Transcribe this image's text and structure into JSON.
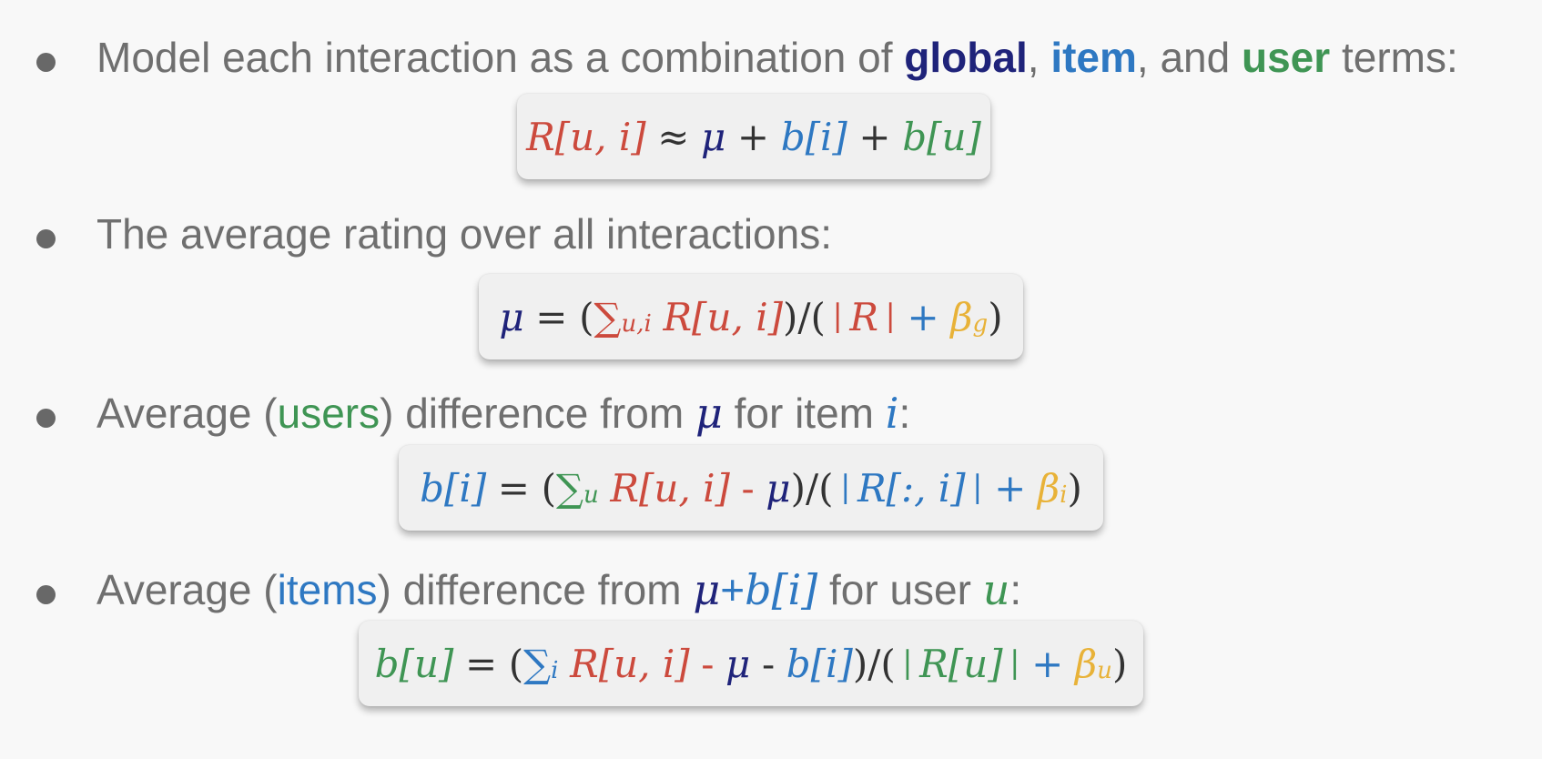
{
  "bullets": [
    {
      "parts": [
        "Model each interaction as a combination of ",
        "global",
        ", ",
        "item",
        ", and ",
        "user",
        " terms:"
      ]
    },
    {
      "parts": [
        "The average rating over all interactions:"
      ]
    },
    {
      "parts": [
        "Average (",
        "users",
        ") difference from ",
        "μ",
        " for item ",
        "i",
        ":"
      ]
    },
    {
      "parts": [
        "Average (",
        "items",
        ") difference from ",
        "μ",
        "+",
        "b[i]",
        " for user ",
        "u",
        ":"
      ]
    }
  ],
  "formulas": {
    "f1": {
      "r": "R[u, i]",
      "approx": "≈",
      "mu": "μ",
      "plus1": "+",
      "bi": "b[i]",
      "plus2": "+",
      "bu": "b[u]"
    },
    "f2": {
      "mu": "μ",
      "eq": "=",
      "open": "(",
      "sigma": "∑",
      "sub": "u,i",
      "r": "R[u, i]",
      "close_div": ")/(",
      "bar1": "|",
      "R": "R",
      "bar2": "|",
      "plus": "+",
      "beta": "β",
      "beta_sub": "g",
      "close": ")"
    },
    "f3": {
      "bi": "b[i]",
      "eq": "=",
      "open": "(",
      "sigma": "∑",
      "sub": "u",
      "r": "R[u, i]",
      "minus": "-",
      "mu": "μ",
      "close_div": ")/(",
      "bar1": "|",
      "rcol": "R[:, i]",
      "bar2": "|",
      "plus": "+",
      "beta": "β",
      "beta_sub": "i",
      "close": ")"
    },
    "f4": {
      "bu": "b[u]",
      "eq": "=",
      "open": "(",
      "sigma": "∑",
      "sub": "i",
      "r": "R[u, i]",
      "minus1": "-",
      "mu": "μ",
      "minus2": "-",
      "bi": "b[i]",
      "close_div": ")/(",
      "bar1": "|",
      "rrow": "R[u]",
      "bar2": "|",
      "plus": "+",
      "beta": "β",
      "beta_sub": "u",
      "close": ")"
    }
  },
  "colors": {
    "background": "#f8f8f8",
    "text": "#6f6f6f",
    "global": "#1f237a",
    "item": "#2e78c2",
    "user": "#3f9554",
    "rating": "#cc4a3d",
    "beta": "#e8b238"
  }
}
